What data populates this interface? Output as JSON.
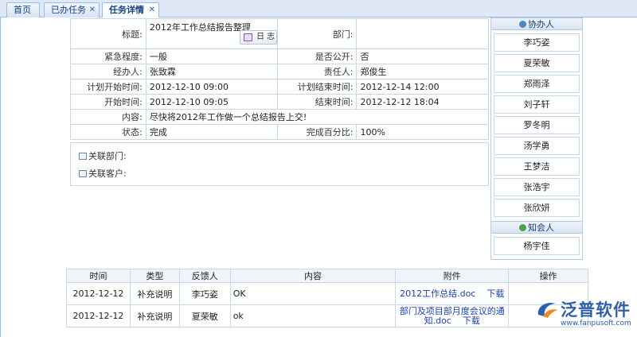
{
  "tabs": [
    {
      "label": "首页",
      "closable": false
    },
    {
      "label": "已办任务",
      "closable": true
    },
    {
      "label": "任务详情",
      "closable": true,
      "active": true
    }
  ],
  "detail": {
    "title_label": "标题:",
    "title_value": "2012年工作总结报告整理",
    "log_button": "日 志",
    "dept_label": "部门:",
    "dept_value": "",
    "urgency_label": "紧急程度:",
    "urgency_value": "一般",
    "public_label": "是否公开:",
    "public_value": "否",
    "handler_label": "经办人:",
    "handler_value": "张致霖",
    "owner_label": "责任人:",
    "owner_value": "郑俊生",
    "plan_start_label": "计划开始时间:",
    "plan_start_value": "2012-12-10 09:00",
    "plan_end_label": "计划结束时间:",
    "plan_end_value": "2012-12-14 12:00",
    "start_label": "开始时间:",
    "start_value": "2012-12-10 09:05",
    "end_label": "结束时间:",
    "end_value": "2012-12-12 18:04",
    "content_label": "内容:",
    "content_value": "尽快将2012年工作做一个总结报告上交!",
    "status_label": "状态:",
    "status_value": "完成",
    "percent_label": "完成百分比:",
    "percent_value": "100%"
  },
  "related": {
    "dept_label": "关联部门:",
    "customer_label": "关联客户:"
  },
  "side": {
    "assist_title": "协办人",
    "assistants": [
      "李巧姿",
      "夏荣敏",
      "郑雨泽",
      "刘子轩",
      "罗冬明",
      "汤学勇",
      "王梦洁",
      "张浩宇",
      "张欣妍"
    ],
    "notify_title": "知会人",
    "notified": [
      "杨宇佳"
    ]
  },
  "feedback": {
    "headers": [
      "时间",
      "类型",
      "反馈人",
      "内容",
      "附件",
      "操作"
    ],
    "rows": [
      {
        "time": "2012-12-12",
        "type": "补充说明",
        "person": "李巧姿",
        "content": "OK",
        "att_name": "2012工作总结.doc",
        "att_action": "下载"
      },
      {
        "time": "2012-12-12",
        "type": "补充说明",
        "person": "夏荣敏",
        "content": "ok",
        "att_name": "部门及项目部月度会议的通知.doc",
        "att_action": "下载"
      }
    ]
  },
  "logo": {
    "brand": "泛普软件",
    "url": "www.fanpusoft.com"
  }
}
